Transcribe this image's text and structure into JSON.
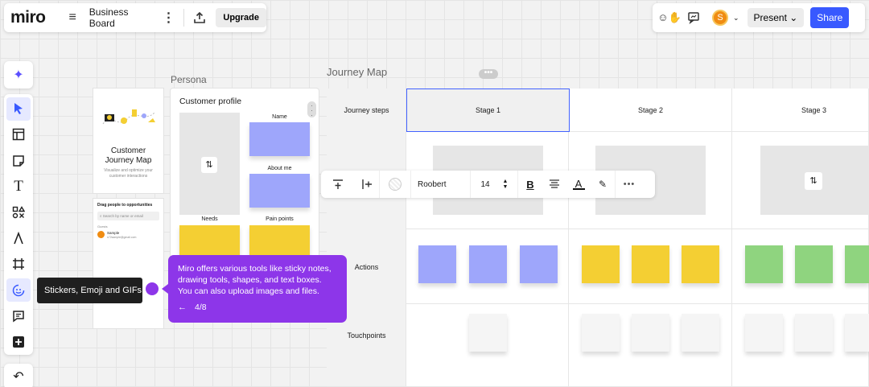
{
  "app": {
    "logo": "miro",
    "board_name": "Business Board",
    "upgrade_label": "Upgrade"
  },
  "top_right": {
    "avatar_initial": "S",
    "present_label": "Present",
    "share_label": "Share"
  },
  "tooltip": {
    "text": "Stickers, Emoji and GIFs"
  },
  "frames": {
    "persona_label": "Persona",
    "journey_label": "Journey Map"
  },
  "template_card": {
    "title": "Customer Journey Map",
    "subtitle": "Visualize and optimize your customer interactions"
  },
  "opportunities_card": {
    "title": "Drag people to opportunities",
    "search_placeholder": "Search by name or email",
    "section": "Guests",
    "user_name": "Sample",
    "user_email": "s72sample@gmail.com"
  },
  "customer_profile": {
    "title": "Customer profile",
    "name_label": "Name",
    "about_label": "About me",
    "needs_label": "Needs",
    "pain_label": "Pain points"
  },
  "journey": {
    "rows": [
      "Journey steps",
      "Actions",
      "Touchpoints"
    ],
    "stages": [
      "Stage 1",
      "Stage 2",
      "Stage 3"
    ]
  },
  "format_bar": {
    "font": "Roobert",
    "size": "14"
  },
  "tip": {
    "text": "Miro offers various tools like sticky notes, drawing tools, shapes, and text boxes. You can also upload images and files.",
    "step": "4/8"
  },
  "colors": {
    "accent": "#3859ff",
    "tip_purple": "#8d36e9",
    "sticky_blue": "#9ea6fb",
    "sticky_yellow": "#f4cf33",
    "sticky_green": "#8fd47f"
  }
}
